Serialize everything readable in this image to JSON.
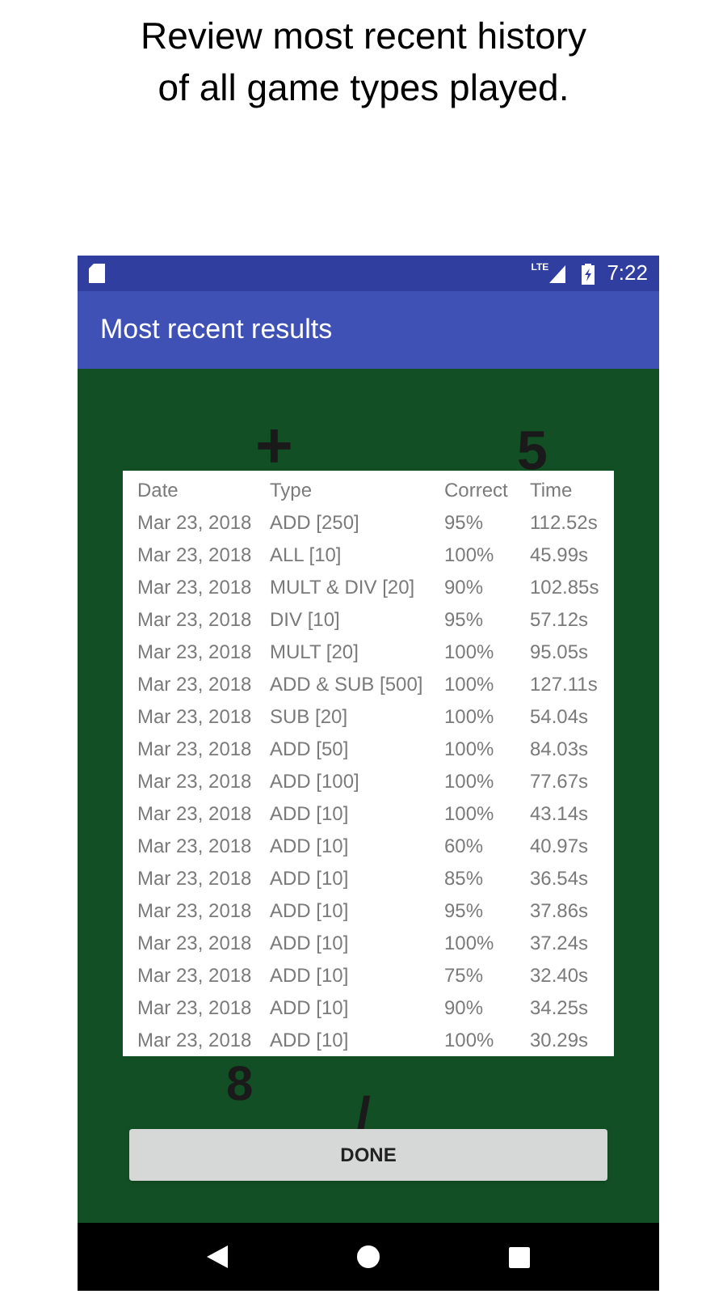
{
  "caption": [
    "Review most recent history",
    "of all game types played."
  ],
  "status_bar": {
    "network": "LTE",
    "time": "7:22"
  },
  "app_bar": {
    "title": "Most recent results"
  },
  "background_symbols": [
    "+",
    "5",
    "8",
    "/"
  ],
  "table": {
    "columns": [
      "Date",
      "Type",
      "Correct",
      "Time"
    ],
    "rows": [
      [
        "Mar 23, 2018",
        "ADD [250]",
        "95%",
        "112.52s"
      ],
      [
        "Mar 23, 2018",
        "ALL [10]",
        "100%",
        "45.99s"
      ],
      [
        "Mar 23, 2018",
        "MULT & DIV [20]",
        "90%",
        "102.85s"
      ],
      [
        "Mar 23, 2018",
        "DIV [10]",
        "95%",
        "57.12s"
      ],
      [
        "Mar 23, 2018",
        "MULT [20]",
        "100%",
        "95.05s"
      ],
      [
        "Mar 23, 2018",
        "ADD & SUB [500]",
        "100%",
        "127.11s"
      ],
      [
        "Mar 23, 2018",
        "SUB [20]",
        "100%",
        "54.04s"
      ],
      [
        "Mar 23, 2018",
        "ADD [50]",
        "100%",
        "84.03s"
      ],
      [
        "Mar 23, 2018",
        "ADD [100]",
        "100%",
        "77.67s"
      ],
      [
        "Mar 23, 2018",
        "ADD [10]",
        "100%",
        "43.14s"
      ],
      [
        "Mar 23, 2018",
        "ADD [10]",
        "60%",
        "40.97s"
      ],
      [
        "Mar 23, 2018",
        "ADD [10]",
        "85%",
        "36.54s"
      ],
      [
        "Mar 23, 2018",
        "ADD [10]",
        "95%",
        "37.86s"
      ],
      [
        "Mar 23, 2018",
        "ADD [10]",
        "100%",
        "37.24s"
      ],
      [
        "Mar 23, 2018",
        "ADD [10]",
        "75%",
        "32.40s"
      ],
      [
        "Mar 23, 2018",
        "ADD [10]",
        "90%",
        "34.25s"
      ],
      [
        "Mar 23, 2018",
        "ADD [10]",
        "100%",
        "30.29s"
      ]
    ]
  },
  "button": "DONE"
}
